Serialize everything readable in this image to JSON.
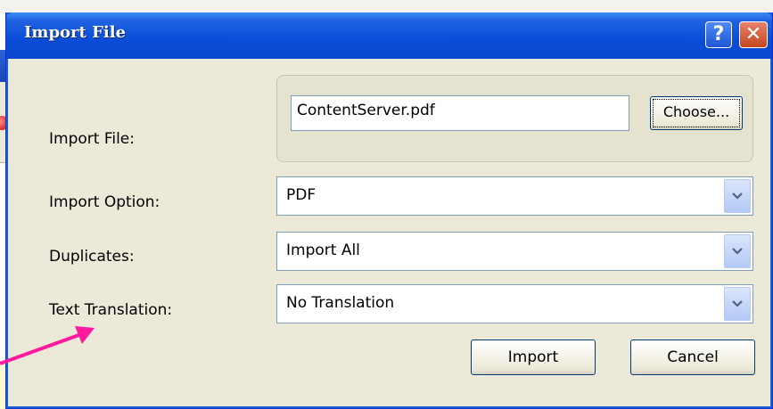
{
  "dialog": {
    "title": "Import File",
    "help_glyph": "?",
    "close_glyph": "✕"
  },
  "form": {
    "import_file_label": "Import File:",
    "import_file_value": "ContentServer.pdf",
    "choose_label": "Choose...",
    "import_option_label": "Import Option:",
    "import_option_value": "PDF",
    "duplicates_label": "Duplicates:",
    "duplicates_value": "Import All",
    "text_translation_label": "Text Translation:",
    "text_translation_value": "No Translation"
  },
  "actions": {
    "import_label": "Import",
    "cancel_label": "Cancel"
  },
  "colors": {
    "titlebar": "#0a4cd8",
    "dialog_bg": "#ece9d8",
    "annotation_arrow": "#ff1aa0"
  }
}
